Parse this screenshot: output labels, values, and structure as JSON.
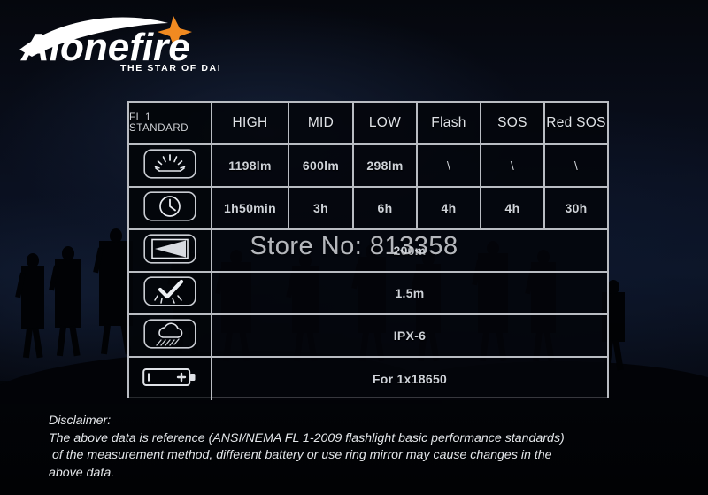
{
  "brand": {
    "name": "Alonefire",
    "tagline": "THE STAR OF DARK",
    "star_color": "#f08a21",
    "text_color": "#ffffff"
  },
  "watermark": {
    "text": "Store No: 813358"
  },
  "table": {
    "header": {
      "standard_label": "FL 1 STANDARD",
      "modes": [
        "HIGH",
        "MID",
        "LOW",
        "Flash",
        "SOS",
        "Red SOS"
      ]
    },
    "rows": [
      {
        "icon": "lumens-icon",
        "type": "per-mode",
        "values": [
          "1198lm",
          "600lm",
          "298lm",
          "\\",
          "\\",
          "\\"
        ]
      },
      {
        "icon": "runtime-clock-icon",
        "type": "per-mode",
        "values": [
          "1h50min",
          "3h",
          "6h",
          "4h",
          "4h",
          "30h"
        ]
      },
      {
        "icon": "beam-distance-icon",
        "type": "single",
        "value": "200m"
      },
      {
        "icon": "impact-resistance-icon",
        "type": "single",
        "value": "1.5m"
      },
      {
        "icon": "water-resistance-icon",
        "type": "single",
        "value": "IPX-6"
      },
      {
        "icon": "battery-icon",
        "type": "single",
        "value": "For  1x18650"
      }
    ]
  },
  "disclaimer": {
    "title": "Disclaimer:",
    "line1": "The above data is reference (ANSI/NEMA FL 1-2009 flashlight basic performance standards)",
    "line2": " of the measurement method, different battery or use ring mirror may cause changes in the",
    "line3": "above data."
  }
}
